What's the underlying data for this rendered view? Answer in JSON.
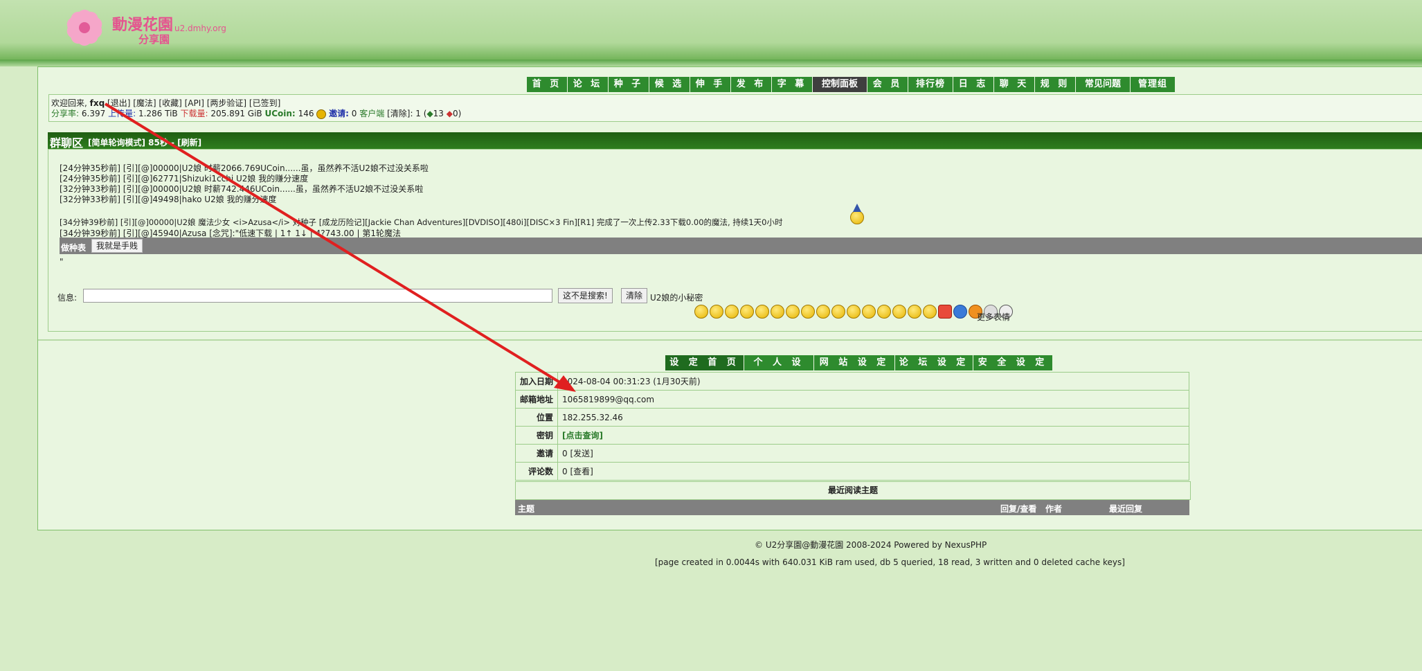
{
  "logo": {
    "title": "動漫花園",
    "subtitle": "分享園",
    "url": "u2.dmhy.org"
  },
  "nav": [
    "首 页",
    "论 坛",
    "种 子",
    "候 选",
    "伸 手",
    "发 布",
    "字 幕",
    "控制面板",
    "会 员",
    "排行榜",
    "日 志",
    "聊 天",
    "规 则",
    "常见问题",
    "管理组"
  ],
  "user": {
    "welcome": "欢迎回来,",
    "name": "fxq",
    "links": "[退出] [魔法] [收藏] [API] [两步验证] [已签到]",
    "ratio_label": "分享率:",
    "ratio": "6.397",
    "upload_label": "上传量:",
    "upload": "1.286 TiB",
    "download_label": "下载量:",
    "download": "205.891 GiB",
    "ucoin_label": "UCoin:",
    "ucoin": "146",
    "invite_label": "邀请:",
    "invite": "0",
    "client_label": "客户端",
    "clear": "[清除]: 1 (",
    "up": "13",
    "down": "0)"
  },
  "chat": {
    "title": "群聊区",
    "mode": "[简单轮询模式] 85秒 - [刷新]",
    "lines": [
      "[24分钟35秒前] [引][@]00000|U2娘 时薪2066.769UCoin......虽，虽然养不活U2娘不过没关系啦",
      "[24分钟35秒前] [引][@]62771|Shizuki1cchi U2娘 我的赚分速度",
      "[32分钟33秒前] [引][@]00000|U2娘 时薪742.446UCoin......虽，虽然养不活U2娘不过没关系啦",
      "[32分钟33秒前] [引][@]49498|hako U2娘 我的赚分速度",
      "[34分钟39秒前] [引][@]00000|U2娘 魔法少女 <i>Azusa</i> 对种子 [成龙历险记][Jackie Chan Adventures][DVDISO][480i][DISC×3 Fin][R1] 完成了一次上传2.33下载0.00的魔法, 持续1天0小时",
      "[34分钟39秒前] [引][@]45940|Azusa [念咒]:\"低速下载 | 1↑ 1↓ | 4?743.00 | 第1轮魔法"
    ],
    "bar_label": "做种表",
    "bar_button": "我就是手贱",
    "quote_mark": "\"",
    "msg_label": "信息:",
    "send_button": "这不是搜索!",
    "clear_button": "清除",
    "secret": "U2娘的小秘密",
    "more_smileys": "更多表情"
  },
  "settings_tabs": [
    "设 定 首 页",
    "个 人 设 定",
    "网 站 设 定",
    "论 坛 设 定",
    "安 全 设 定"
  ],
  "details": [
    {
      "label": "加入日期",
      "value": "2024-08-04 00:31:23 (1月30天前)"
    },
    {
      "label": "邮箱地址",
      "value": "1065819899@qq.com"
    },
    {
      "label": "位置",
      "value": "182.255.32.46"
    },
    {
      "label": "密钥",
      "value": "[点击查询]"
    },
    {
      "label": "邀请",
      "value": "0 [发送]"
    },
    {
      "label": "评论数",
      "value": "0 [查看]"
    }
  ],
  "recent": {
    "title": "最近阅读主题",
    "col_topic": "主题",
    "col_replies": "回复/查看",
    "col_author": "作者",
    "col_last": "最近回复"
  },
  "footer": {
    "copyright": "© U2分享園@動漫花園 2008-2024 Powered by NexusPHP",
    "stats": "[page created in 0.0044s with 640.031 KiB ram used, db 5 queried, 18 read, 3 written and 0 deleted cache keys]"
  }
}
